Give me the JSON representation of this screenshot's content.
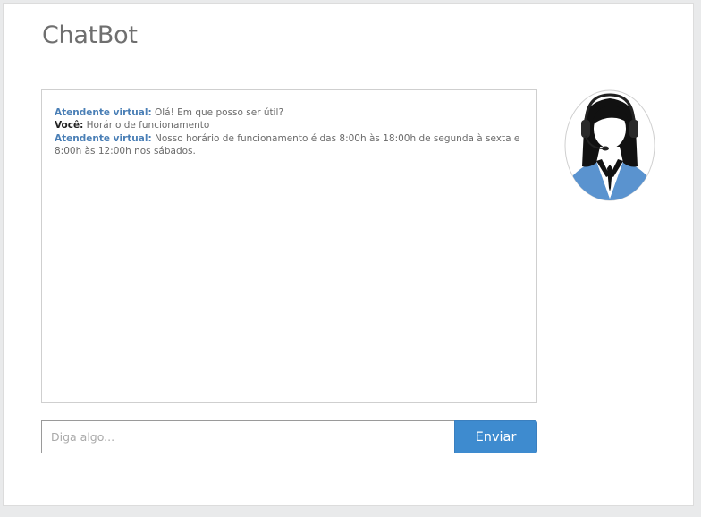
{
  "app": {
    "title": "ChatBot"
  },
  "conversation": [
    {
      "sender": "Atendente virtual:",
      "role": "bot",
      "text": "Olá! Em que posso ser útil?"
    },
    {
      "sender": "Você:",
      "role": "user",
      "text": "Horário de funcionamento"
    },
    {
      "sender": "Atendente virtual:",
      "role": "bot",
      "text": "Nosso horário de funcionamento é das 8:00h às 18:00h de segunda à sexta e 8:00h às 12:00h nos sábados."
    }
  ],
  "composer": {
    "placeholder": "Diga algo...",
    "send_label": "Enviar"
  },
  "colors": {
    "bot_sender": "#4a7fb6",
    "send_button": "#3e8bcf",
    "avatar_uniform": "#5a93cf"
  },
  "icons": {
    "avatar": "virtual-agent-headset-icon"
  }
}
